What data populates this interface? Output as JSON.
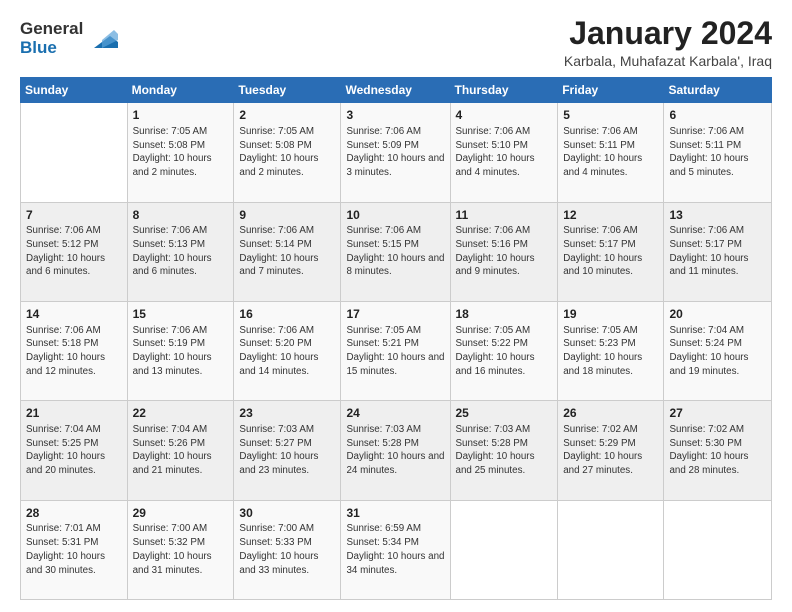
{
  "header": {
    "logo_general": "General",
    "logo_blue": "Blue",
    "title": "January 2024",
    "location": "Karbala, Muhafazat Karbala', Iraq"
  },
  "days_of_week": [
    "Sunday",
    "Monday",
    "Tuesday",
    "Wednesday",
    "Thursday",
    "Friday",
    "Saturday"
  ],
  "weeks": [
    [
      {
        "day": "",
        "sunrise": "",
        "sunset": "",
        "daylight": ""
      },
      {
        "day": "1",
        "sunrise": "Sunrise: 7:05 AM",
        "sunset": "Sunset: 5:08 PM",
        "daylight": "Daylight: 10 hours and 2 minutes."
      },
      {
        "day": "2",
        "sunrise": "Sunrise: 7:05 AM",
        "sunset": "Sunset: 5:08 PM",
        "daylight": "Daylight: 10 hours and 2 minutes."
      },
      {
        "day": "3",
        "sunrise": "Sunrise: 7:06 AM",
        "sunset": "Sunset: 5:09 PM",
        "daylight": "Daylight: 10 hours and 3 minutes."
      },
      {
        "day": "4",
        "sunrise": "Sunrise: 7:06 AM",
        "sunset": "Sunset: 5:10 PM",
        "daylight": "Daylight: 10 hours and 4 minutes."
      },
      {
        "day": "5",
        "sunrise": "Sunrise: 7:06 AM",
        "sunset": "Sunset: 5:11 PM",
        "daylight": "Daylight: 10 hours and 4 minutes."
      },
      {
        "day": "6",
        "sunrise": "Sunrise: 7:06 AM",
        "sunset": "Sunset: 5:11 PM",
        "daylight": "Daylight: 10 hours and 5 minutes."
      }
    ],
    [
      {
        "day": "7",
        "sunrise": "Sunrise: 7:06 AM",
        "sunset": "Sunset: 5:12 PM",
        "daylight": "Daylight: 10 hours and 6 minutes."
      },
      {
        "day": "8",
        "sunrise": "Sunrise: 7:06 AM",
        "sunset": "Sunset: 5:13 PM",
        "daylight": "Daylight: 10 hours and 6 minutes."
      },
      {
        "day": "9",
        "sunrise": "Sunrise: 7:06 AM",
        "sunset": "Sunset: 5:14 PM",
        "daylight": "Daylight: 10 hours and 7 minutes."
      },
      {
        "day": "10",
        "sunrise": "Sunrise: 7:06 AM",
        "sunset": "Sunset: 5:15 PM",
        "daylight": "Daylight: 10 hours and 8 minutes."
      },
      {
        "day": "11",
        "sunrise": "Sunrise: 7:06 AM",
        "sunset": "Sunset: 5:16 PM",
        "daylight": "Daylight: 10 hours and 9 minutes."
      },
      {
        "day": "12",
        "sunrise": "Sunrise: 7:06 AM",
        "sunset": "Sunset: 5:17 PM",
        "daylight": "Daylight: 10 hours and 10 minutes."
      },
      {
        "day": "13",
        "sunrise": "Sunrise: 7:06 AM",
        "sunset": "Sunset: 5:17 PM",
        "daylight": "Daylight: 10 hours and 11 minutes."
      }
    ],
    [
      {
        "day": "14",
        "sunrise": "Sunrise: 7:06 AM",
        "sunset": "Sunset: 5:18 PM",
        "daylight": "Daylight: 10 hours and 12 minutes."
      },
      {
        "day": "15",
        "sunrise": "Sunrise: 7:06 AM",
        "sunset": "Sunset: 5:19 PM",
        "daylight": "Daylight: 10 hours and 13 minutes."
      },
      {
        "day": "16",
        "sunrise": "Sunrise: 7:06 AM",
        "sunset": "Sunset: 5:20 PM",
        "daylight": "Daylight: 10 hours and 14 minutes."
      },
      {
        "day": "17",
        "sunrise": "Sunrise: 7:05 AM",
        "sunset": "Sunset: 5:21 PM",
        "daylight": "Daylight: 10 hours and 15 minutes."
      },
      {
        "day": "18",
        "sunrise": "Sunrise: 7:05 AM",
        "sunset": "Sunset: 5:22 PM",
        "daylight": "Daylight: 10 hours and 16 minutes."
      },
      {
        "day": "19",
        "sunrise": "Sunrise: 7:05 AM",
        "sunset": "Sunset: 5:23 PM",
        "daylight": "Daylight: 10 hours and 18 minutes."
      },
      {
        "day": "20",
        "sunrise": "Sunrise: 7:04 AM",
        "sunset": "Sunset: 5:24 PM",
        "daylight": "Daylight: 10 hours and 19 minutes."
      }
    ],
    [
      {
        "day": "21",
        "sunrise": "Sunrise: 7:04 AM",
        "sunset": "Sunset: 5:25 PM",
        "daylight": "Daylight: 10 hours and 20 minutes."
      },
      {
        "day": "22",
        "sunrise": "Sunrise: 7:04 AM",
        "sunset": "Sunset: 5:26 PM",
        "daylight": "Daylight: 10 hours and 21 minutes."
      },
      {
        "day": "23",
        "sunrise": "Sunrise: 7:03 AM",
        "sunset": "Sunset: 5:27 PM",
        "daylight": "Daylight: 10 hours and 23 minutes."
      },
      {
        "day": "24",
        "sunrise": "Sunrise: 7:03 AM",
        "sunset": "Sunset: 5:28 PM",
        "daylight": "Daylight: 10 hours and 24 minutes."
      },
      {
        "day": "25",
        "sunrise": "Sunrise: 7:03 AM",
        "sunset": "Sunset: 5:28 PM",
        "daylight": "Daylight: 10 hours and 25 minutes."
      },
      {
        "day": "26",
        "sunrise": "Sunrise: 7:02 AM",
        "sunset": "Sunset: 5:29 PM",
        "daylight": "Daylight: 10 hours and 27 minutes."
      },
      {
        "day": "27",
        "sunrise": "Sunrise: 7:02 AM",
        "sunset": "Sunset: 5:30 PM",
        "daylight": "Daylight: 10 hours and 28 minutes."
      }
    ],
    [
      {
        "day": "28",
        "sunrise": "Sunrise: 7:01 AM",
        "sunset": "Sunset: 5:31 PM",
        "daylight": "Daylight: 10 hours and 30 minutes."
      },
      {
        "day": "29",
        "sunrise": "Sunrise: 7:00 AM",
        "sunset": "Sunset: 5:32 PM",
        "daylight": "Daylight: 10 hours and 31 minutes."
      },
      {
        "day": "30",
        "sunrise": "Sunrise: 7:00 AM",
        "sunset": "Sunset: 5:33 PM",
        "daylight": "Daylight: 10 hours and 33 minutes."
      },
      {
        "day": "31",
        "sunrise": "Sunrise: 6:59 AM",
        "sunset": "Sunset: 5:34 PM",
        "daylight": "Daylight: 10 hours and 34 minutes."
      },
      {
        "day": "",
        "sunrise": "",
        "sunset": "",
        "daylight": ""
      },
      {
        "day": "",
        "sunrise": "",
        "sunset": "",
        "daylight": ""
      },
      {
        "day": "",
        "sunrise": "",
        "sunset": "",
        "daylight": ""
      }
    ]
  ]
}
